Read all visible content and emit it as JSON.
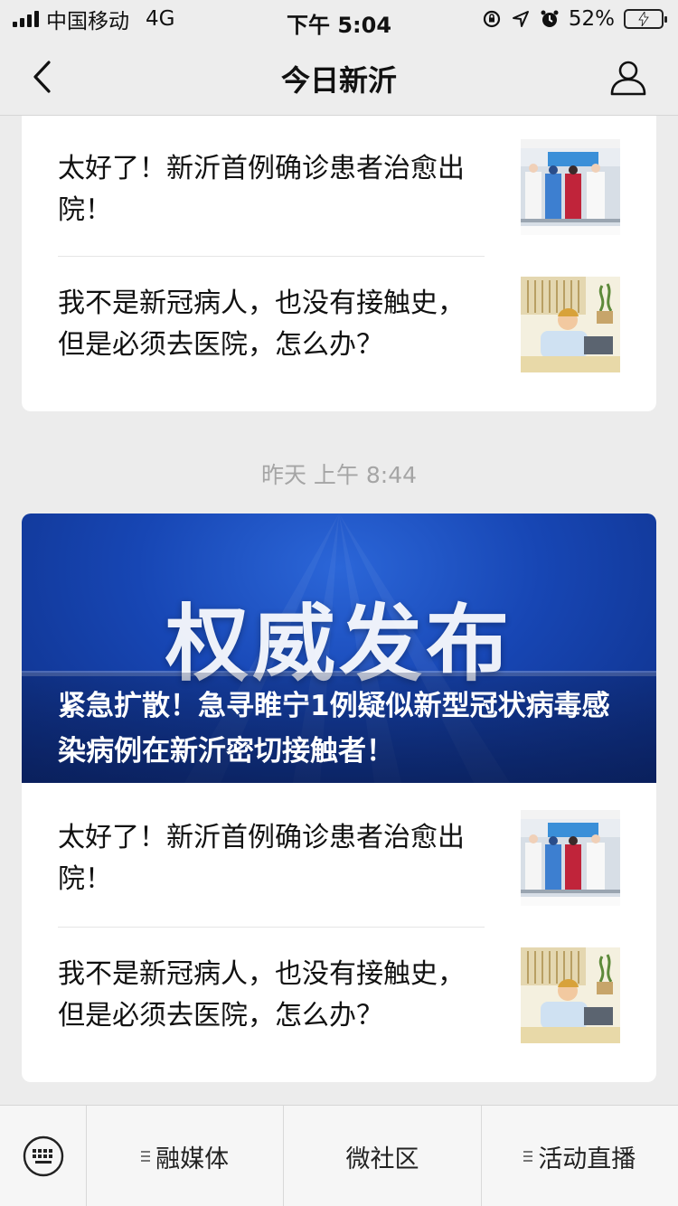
{
  "status_bar": {
    "carrier": "中国移动",
    "network": "4G",
    "time": "下午 5:04",
    "battery_percent": "52%",
    "battery_level": 0.52,
    "icons": [
      "signal-icon",
      "lock-rotation-icon",
      "location-arrow-icon",
      "alarm-icon",
      "battery-charging-icon"
    ]
  },
  "nav": {
    "title": "今日新沂",
    "back_icon": "chevron-left-icon",
    "profile_icon": "person-icon"
  },
  "top_card": {
    "articles": [
      {
        "title": "太好了！新沂首例确诊患者治愈出院！",
        "thumb": "doctors-photo"
      },
      {
        "title": "我不是新冠病人，也没有接触史，但是必须去医院，怎么办？",
        "thumb": "illustration-person-laptop"
      }
    ]
  },
  "timestamp": "昨天 上午 8:44",
  "bottom_card": {
    "banner": {
      "big_text": "权威发布",
      "caption": "紧急扩散！急寻睢宁1例疑似新型冠状病毒感染病例在新沂密切接触者！"
    },
    "articles": [
      {
        "title": "太好了！新沂首例确诊患者治愈出院！",
        "thumb": "doctors-photo"
      },
      {
        "title": "我不是新冠病人，也没有接触史，但是必须去医院，怎么办？",
        "thumb": "illustration-person-laptop"
      }
    ]
  },
  "menu": {
    "keyboard_icon": "keyboard-icon",
    "items": [
      {
        "label": "融媒体",
        "has_submenu": true
      },
      {
        "label": "微社区",
        "has_submenu": false
      },
      {
        "label": "活动直播",
        "has_submenu": true
      }
    ]
  }
}
